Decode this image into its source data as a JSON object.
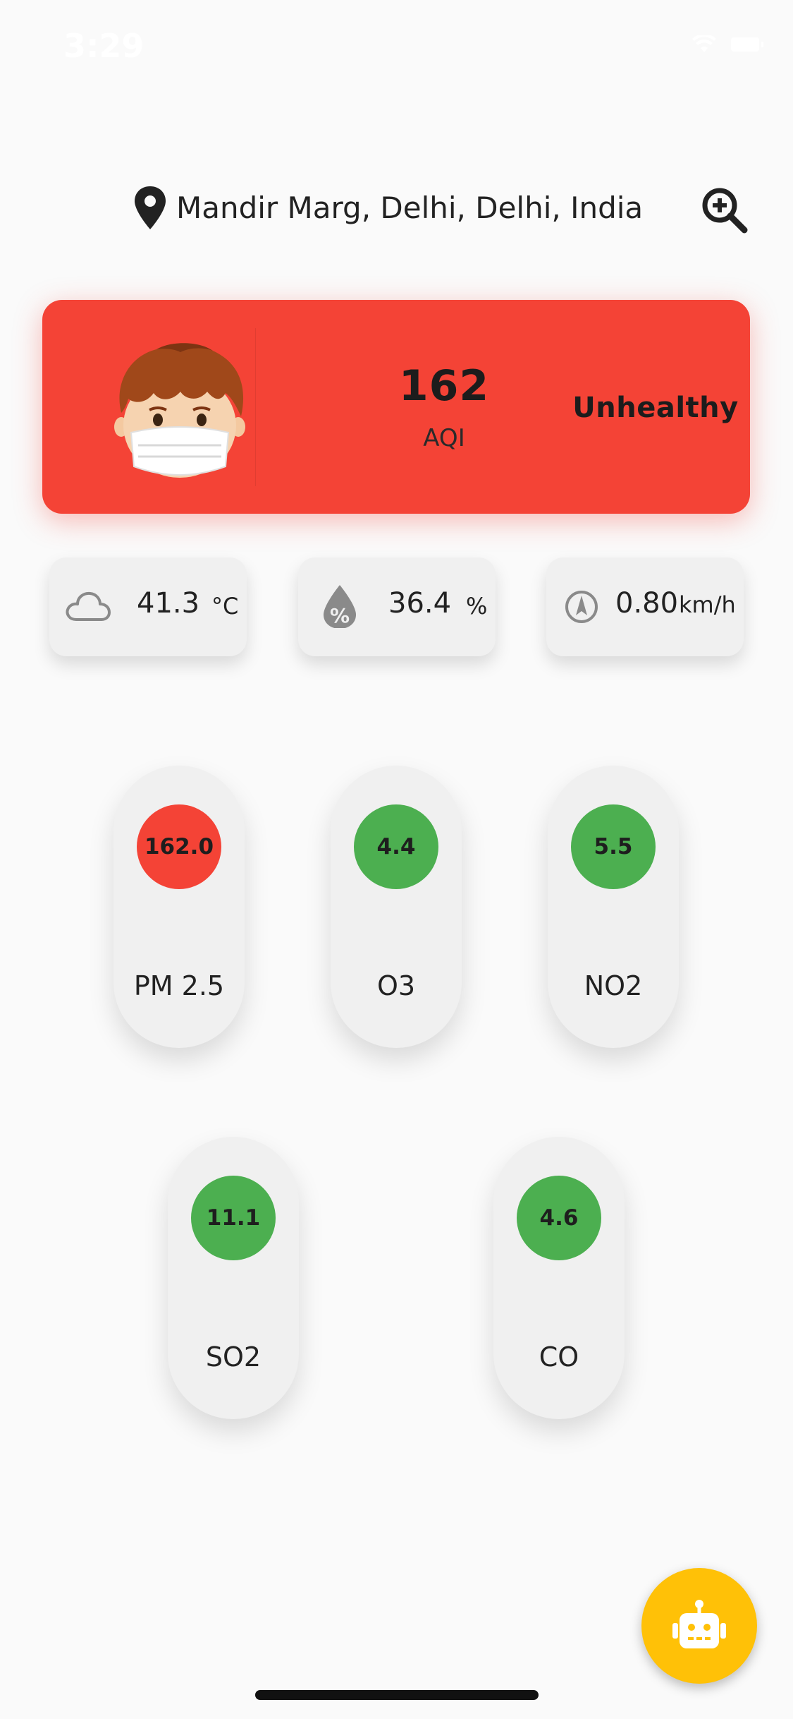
{
  "status_bar": {
    "time": "3:29",
    "wifi_icon": "wifi-icon",
    "battery_icon": "battery-icon"
  },
  "location": {
    "icon": "map-pin-icon",
    "text": "Mandir Marg, Delhi, Delhi, India",
    "zoom_icon": "zoom-in-icon"
  },
  "aqi": {
    "value": "162",
    "label": "AQI",
    "status": "Unhealthy",
    "avatar": "boy-with-mask-icon",
    "color": "#f44336"
  },
  "weather": {
    "temperature": {
      "value": "41.3",
      "unit": "°C",
      "icon": "cloud-icon"
    },
    "humidity": {
      "value": "36.4",
      "unit": "%",
      "icon": "humidity-drop-icon"
    },
    "wind": {
      "value": "0.80",
      "unit": "km/h",
      "icon": "compass-icon"
    }
  },
  "pollutants": [
    {
      "name": "PM 2.5",
      "value": "162.0",
      "color": "#f44336"
    },
    {
      "name": "O3",
      "value": "4.4",
      "color": "#4caf50"
    },
    {
      "name": "NO2",
      "value": "5.5",
      "color": "#4caf50"
    },
    {
      "name": "SO2",
      "value": "11.1",
      "color": "#4caf50"
    },
    {
      "name": "CO",
      "value": "4.6",
      "color": "#4caf50"
    }
  ],
  "fab": {
    "icon": "robot-icon",
    "color": "#ffc107"
  }
}
